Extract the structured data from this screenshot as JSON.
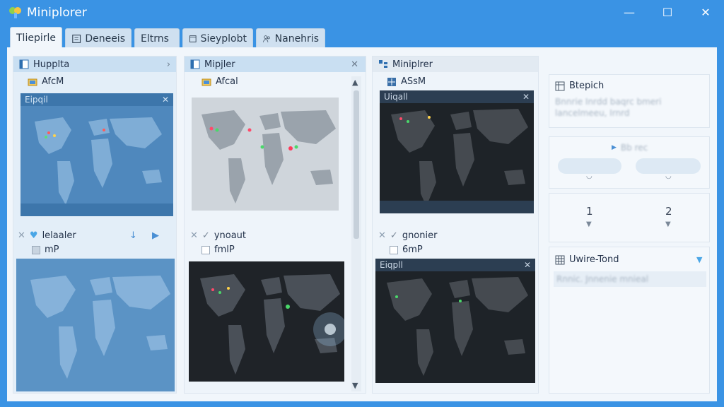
{
  "app": {
    "title": "Miniplorer"
  },
  "window_controls": {
    "minimize": "—",
    "maximize": "☐",
    "close": "✕"
  },
  "tabs": [
    {
      "label": "Tliepirle",
      "icon": "none"
    },
    {
      "label": "Deneeis",
      "icon": "document-icon"
    },
    {
      "label": "Eltrns",
      "icon": "none"
    },
    {
      "label": "Sieyplobt",
      "icon": "window-icon"
    },
    {
      "label": "Nanehris",
      "icon": "people-icon"
    }
  ],
  "col1": {
    "header": "Hupplta",
    "header_arrow": "›",
    "sub": "AfcM",
    "map_title": "Eipqil",
    "map_close": "✕",
    "row1_label": "lelaaler",
    "row2_label": "mP"
  },
  "col2": {
    "header": "Mipjler",
    "header_close": "✕",
    "sub": "Afcal",
    "row1_label": "ynoaut",
    "row2_label": "fmlP"
  },
  "col3": {
    "header": "Miniplrer",
    "sub": "ASsM",
    "map1_title": "Uiqall",
    "map1_close": "✕",
    "row1_label": "gnonier",
    "row2_label": "6mP",
    "map2_title": "Eiqpll",
    "map2_close": "✕"
  },
  "right": {
    "card1_title": "Btepich",
    "card1_text": "Bnnrie Inrdd baqrc bmeri lancelmeeu, Irnrd",
    "card2_title": "Bb rec",
    "num1": "1",
    "num2": "2",
    "card4_title": "Uwire-Tond",
    "card4_text": "Rnnic. Jnnenie mnieal"
  },
  "colors": {
    "titlebar": "#3a93e4",
    "content_bg": "#f1f6fb",
    "map_blue": "#4e88bd",
    "map_dark": "#1e2328",
    "accent": "#2e8be0"
  }
}
